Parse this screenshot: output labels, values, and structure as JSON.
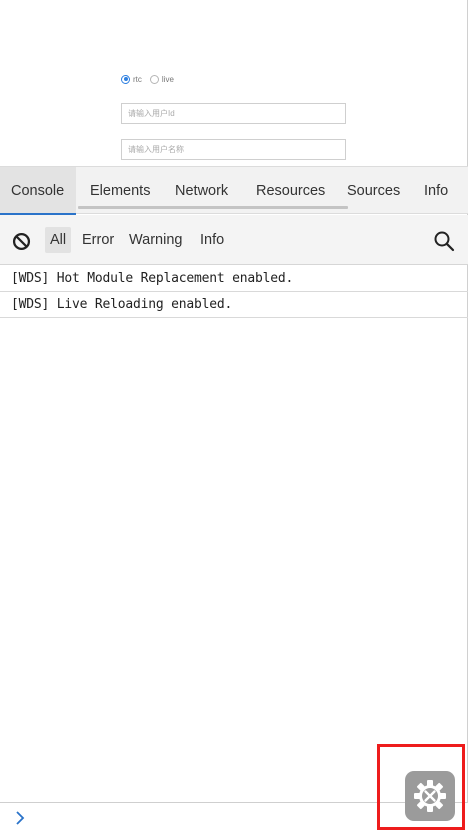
{
  "page": {
    "radio_options": [
      {
        "label": "rtc",
        "checked": true
      },
      {
        "label": "live",
        "checked": false
      }
    ],
    "user_id_placeholder": "请输入用户Id",
    "user_name_placeholder": "请输入用户名称"
  },
  "devtools": {
    "tabs": [
      {
        "label": "Console",
        "active": true
      },
      {
        "label": "Elements",
        "active": false
      },
      {
        "label": "Network",
        "active": false
      },
      {
        "label": "Resources",
        "active": false
      },
      {
        "label": "Sources",
        "active": false
      },
      {
        "label": "Info",
        "active": false
      }
    ],
    "filters": [
      {
        "label": "All",
        "active": true
      },
      {
        "label": "Error",
        "active": false
      },
      {
        "label": "Warning",
        "active": false
      },
      {
        "label": "Info",
        "active": false
      }
    ],
    "logs": [
      "[WDS] Hot Module Replacement enabled.",
      "[WDS] Live Reloading enabled."
    ],
    "icons": {
      "clear": "clear-console-icon",
      "search": "search-icon",
      "prompt": "prompt-chevron-icon",
      "floating_button": "devtools-gear-icon"
    },
    "colors": {
      "active_tab_underline": "#2a73c9",
      "radio_accent": "#2d7fe0",
      "highlight_box": "#ee1c1c",
      "floating_button": "#9b9b9b"
    }
  }
}
